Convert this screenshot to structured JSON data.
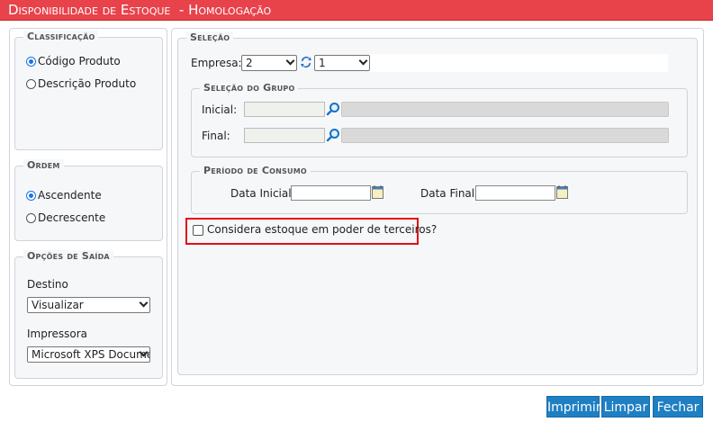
{
  "window": {
    "title": "Disponibilidade de Estoque  - Homologação"
  },
  "classificacao": {
    "legend": "Classificação",
    "options": [
      {
        "label": "Código Produto",
        "selected": true
      },
      {
        "label": "Descrição Produto",
        "selected": false
      }
    ]
  },
  "ordem": {
    "legend": "Ordem",
    "options": [
      {
        "label": "Ascendente",
        "selected": true
      },
      {
        "label": "Decrescente",
        "selected": false
      }
    ]
  },
  "saida": {
    "legend": "Opções de Saída",
    "destino_label": "Destino",
    "destino_value": "Visualizar",
    "impressora_label": "Impressora",
    "impressora_value": "Microsoft XPS Document Writer"
  },
  "selecao": {
    "legend": "Seleção",
    "empresa_label": "Empresa:",
    "empresa_value": "2",
    "filial_value": "1",
    "grupo": {
      "legend": "Seleção do Grupo",
      "inicial_label": "Inicial:",
      "final_label": "Final:"
    },
    "periodo": {
      "legend": "Período de Consumo",
      "data_inicial_label": "Data Inicial:",
      "data_final_label": "Data Final:"
    },
    "terceiros_label": "Considera estoque em poder de terceiros?",
    "terceiros_checked": false
  },
  "buttons": {
    "imprimir": "Imprimir",
    "limpar": "Limpar",
    "fechar": "Fechar"
  },
  "colors": {
    "title_bg": "#e8424b",
    "button_bg": "#1f7fc3",
    "highlight": "#e0101a",
    "radio_on": "#1a73e8"
  },
  "icons": {
    "search": "magnifier-icon",
    "swap": "swap-arrows-icon",
    "calendar": "calendar-icon"
  }
}
